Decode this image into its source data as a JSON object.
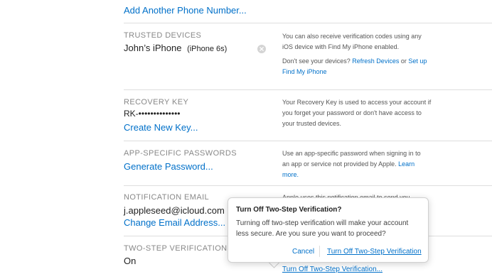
{
  "phone": {
    "add_link": "Add Another Phone Number..."
  },
  "trusted_devices": {
    "title": "TRUSTED DEVICES",
    "device_name": "John’s iPhone",
    "device_model": "(iPhone 6s)",
    "remove_icon": "x-circle-icon",
    "desc": "You can also receive verification codes using any iOS device with Find My iPhone enabled.",
    "desc2_prefix": "Don't see your devices?",
    "refresh_link": "Refresh Devices",
    "or_text": "or",
    "setup_link": "Set up Find My iPhone"
  },
  "recovery_key": {
    "title": "RECOVERY KEY",
    "value": "RK-••••••••••••••",
    "create_link": "Create New Key...",
    "desc": "Your Recovery Key is used to access your account if you forget your password or don't have access to your trusted devices."
  },
  "app_passwords": {
    "title": "APP-SPECIFIC PASSWORDS",
    "generate_link": "Generate Password...",
    "desc": "Use an app-specific password when signing in to an app or service not provided by Apple.",
    "learn_more": "Learn more."
  },
  "notification_email": {
    "title": "NOTIFICATION EMAIL",
    "email": "j.appleseed@icloud.com",
    "change_link": "Change Email Address...",
    "desc_partial": "Apple uses this notification email to send you"
  },
  "two_step": {
    "title": "TWO-STEP VERIFICATION",
    "status": "On",
    "turn_off_link": "Turn Off Two-Step Verification..."
  },
  "dialog": {
    "title": "Turn Off Two-Step Verification?",
    "message": "Turning off two-step verification will make your account less secure. Are you sure you want to proceed?",
    "cancel_label": "Cancel",
    "confirm_label": "Turn Off Two-Step Verification"
  },
  "colors": {
    "link": "#0070c9",
    "divider": "#dedede"
  }
}
